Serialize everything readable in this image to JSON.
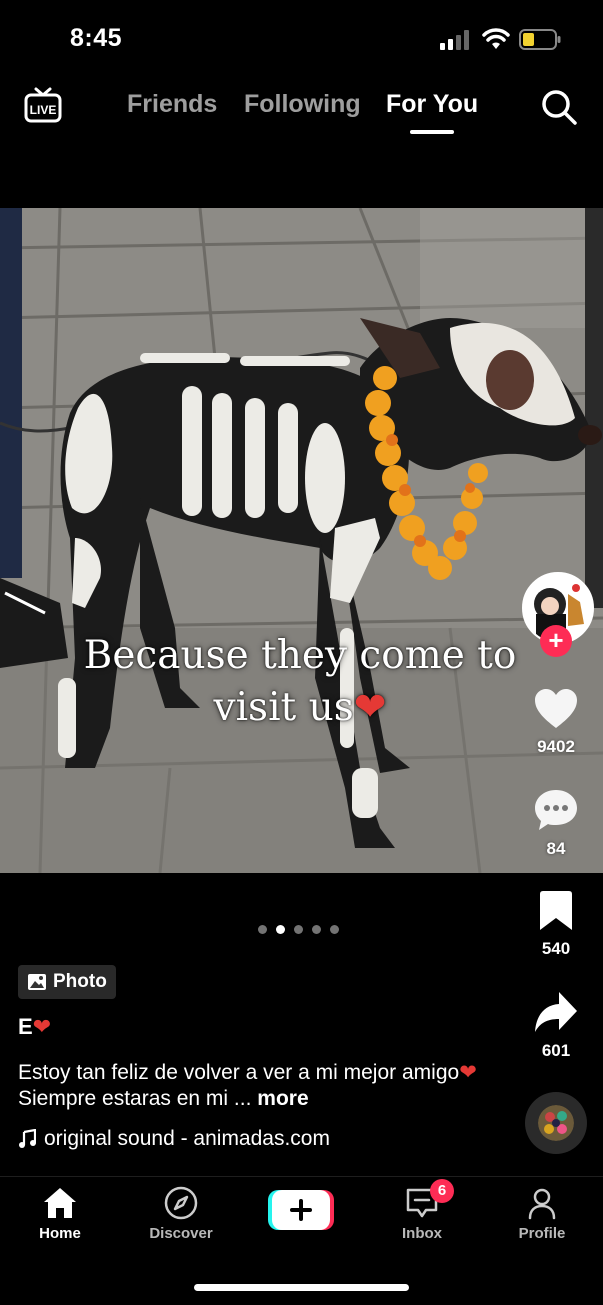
{
  "status_bar": {
    "time": "8:45"
  },
  "top_nav": {
    "live_label": "LIVE",
    "tabs": [
      {
        "label": "Friends",
        "active": false
      },
      {
        "label": "Following",
        "active": false
      },
      {
        "label": "For You",
        "active": true
      }
    ]
  },
  "post": {
    "overlay_text_line1": "Because they come to",
    "overlay_text_line2": "visit us",
    "type_badge": "Photo",
    "username": "E",
    "caption": "Estoy tan feliz de volver a ver a mi mejor amigo",
    "caption_tail": " Siempre estaras en mi ... ",
    "more_label": "more",
    "sound": "original sound - animadas.com",
    "carousel": {
      "total": 5,
      "active_index": 1
    }
  },
  "actions": {
    "likes": "9402",
    "comments": "84",
    "bookmarks": "540",
    "shares": "601"
  },
  "bottom_nav": {
    "items": [
      "Home",
      "Discover",
      "Inbox",
      "Profile"
    ],
    "active": "Home",
    "inbox_badge": "6"
  },
  "colors": {
    "accent": "#fe2c55",
    "teal": "#25f4ee",
    "background": "#000000",
    "battery": "#f2d230"
  },
  "icons": [
    "live-icon",
    "search-icon",
    "heart-icon",
    "comment-icon",
    "bookmark-icon",
    "share-icon",
    "music-note-icon",
    "home-icon",
    "compass-icon",
    "plus-icon",
    "inbox-icon",
    "profile-icon",
    "photo-icon"
  ]
}
